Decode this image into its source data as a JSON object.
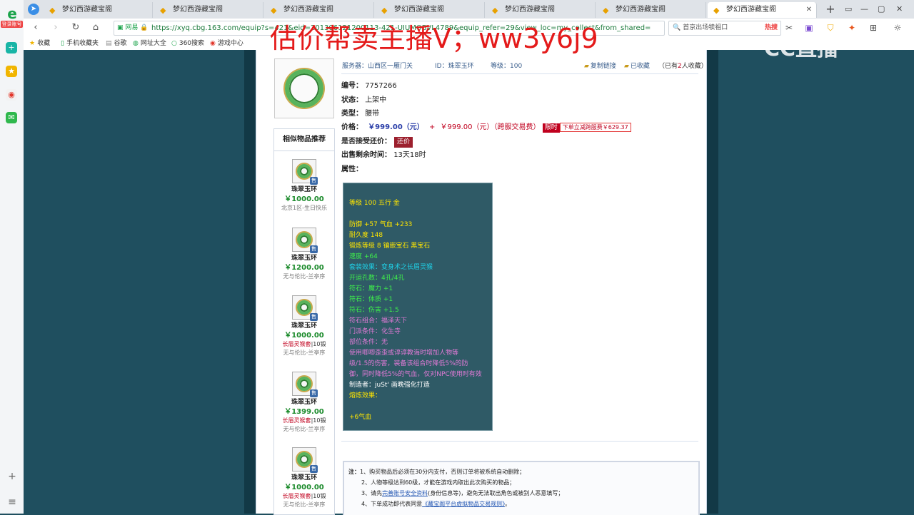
{
  "sidebar": {
    "badge": "登录账号",
    "icons": [
      "add-icon",
      "star-icon",
      "weibo-icon",
      "mail-icon"
    ]
  },
  "tabs": [
    {
      "label": "梦幻西游藏宝阁"
    },
    {
      "label": "梦幻西游藏宝阁"
    },
    {
      "label": "梦幻西游藏宝阁"
    },
    {
      "label": "梦幻西游藏宝阁"
    },
    {
      "label": "梦幻西游藏宝阁"
    },
    {
      "label": "梦幻西游藏宝阁"
    },
    {
      "label": "梦幻西游藏宝阁"
    }
  ],
  "address": {
    "site_label": "网易",
    "url": "https://xyq.cbg.163.com/equip?s=421&eid=201306121200113-421-UIUMOBVL4789&equip_refer=29&view_loc=my_collect&from_shared=1",
    "search_text": "首京出场犊祖口",
    "search_hot": "热搜"
  },
  "bookmarks": [
    "收藏",
    "手机收藏夹",
    "谷歌",
    "网址大全",
    "360搜索",
    "游戏中心"
  ],
  "overlay": {
    "streamer_text": "估价帮卖主播V；ww3y6j9",
    "cc_logo": "CC直播"
  },
  "item": {
    "server_label": "服务器：",
    "server": "山西区一雁门关",
    "id_label": "ID：",
    "id_name": "珠翠玉环",
    "level_label": "等级：",
    "level": "100",
    "copy_link": "复制链接",
    "collected": "已收藏",
    "collect_count_pre": "（已有",
    "collect_count": "2",
    "collect_count_post": "人收藏）",
    "number_label": "编号：",
    "number": "7757266",
    "status_label": "状态：",
    "status": "上架中",
    "type_label": "类型：",
    "type": "腰带",
    "price_label": "价格：",
    "price": "￥999.00（元）",
    "price_plus": "+",
    "price_fee": "￥999.00（元）（跨服交易费）",
    "limit_tag": "限时",
    "promo": "下单立减跨服费￥629.37",
    "bargain_label": "是否接受还价：",
    "bargain_btn": "还价",
    "remain_label": "出售剩余时间：",
    "remain": "13天18时",
    "attr_label": "属性："
  },
  "attributes": [
    {
      "text": "等级 100 五行 金",
      "cls": "y"
    },
    {
      "text": "",
      "cls": "y"
    },
    {
      "text": "防御 +57 气血 +233",
      "cls": "y"
    },
    {
      "text": "耐久度 148",
      "cls": "y"
    },
    {
      "text": "锻炼等级 8 镶嵌宝石 黑宝石",
      "cls": "y"
    },
    {
      "text": "速度 +64",
      "cls": "g"
    },
    {
      "text": "套装效果：变身术之长眉灵猴",
      "cls": "c"
    },
    {
      "text": "开运孔数：4孔/4孔",
      "cls": "g"
    },
    {
      "text": "符石：魔力 +1",
      "cls": "g"
    },
    {
      "text": "符石：体质 +1",
      "cls": "g"
    },
    {
      "text": "符石：伤害 +1.5",
      "cls": "g"
    },
    {
      "text": "符石组合：福泽天下",
      "cls": "m"
    },
    {
      "text": "门派条件：化生寺",
      "cls": "m"
    },
    {
      "text": "部位条件：无",
      "cls": "m"
    },
    {
      "text": "使用唧唧歪歪或谆谆教诲时增加人物等",
      "cls": "m"
    },
    {
      "text": "级/1.5的伤害，装备该组合时降低5%的防",
      "cls": "m"
    },
    {
      "text": "御，同时降低5%的气血，仅对NPC使用时有效",
      "cls": "m"
    },
    {
      "text": "制造者：juSt' 画晚强化打造",
      "cls": "w"
    },
    {
      "text": "熔炼效果：",
      "cls": "y"
    },
    {
      "text": "",
      "cls": "y"
    },
    {
      "text": "+6气血",
      "cls": "y"
    }
  ],
  "similar": {
    "title": "相似物品推荐",
    "badge": "售",
    "items": [
      {
        "name": "珠翠玉环",
        "price": "￥1000.00",
        "extra": "",
        "extra_num": "",
        "server": "北京1区-生日快乐"
      },
      {
        "name": "珠翠玉环",
        "price": "￥1200.00",
        "extra": "",
        "extra_num": "",
        "server": "无与伦比-兰亭序"
      },
      {
        "name": "珠翠玉环",
        "price": "￥1000.00",
        "extra": "长眉灵猴套",
        "extra_num": "|10锻",
        "server": "无与伦比-兰亭序"
      },
      {
        "name": "珠翠玉环",
        "price": "￥1399.00",
        "extra": "长眉灵猴套",
        "extra_num": "|10锻",
        "server": "无与伦比-兰亭序"
      },
      {
        "name": "珠翠玉环",
        "price": "￥1000.00",
        "extra": "长眉灵猴套",
        "extra_num": "|10锻",
        "server": "无与伦比-兰亭序"
      }
    ]
  },
  "notes": {
    "prefix": "注：",
    "n1": "1、购买物品后必须在30分内支付，否则订单将被系统自动删除；",
    "n2": "2、人物等级达到60级，才能在游戏内取出此次购买的物品；",
    "n3_pre": "3、请先",
    "n3_link": "完善账号安全资料",
    "n3_post": "(身份信息等)，避免无法取出角色或被别人恶意填写；",
    "n4_pre": "4、下单成功即代表同意",
    "n4_link": "《藏宝阁平台虚拟物品交易规则》",
    "n4_post": "。"
  }
}
